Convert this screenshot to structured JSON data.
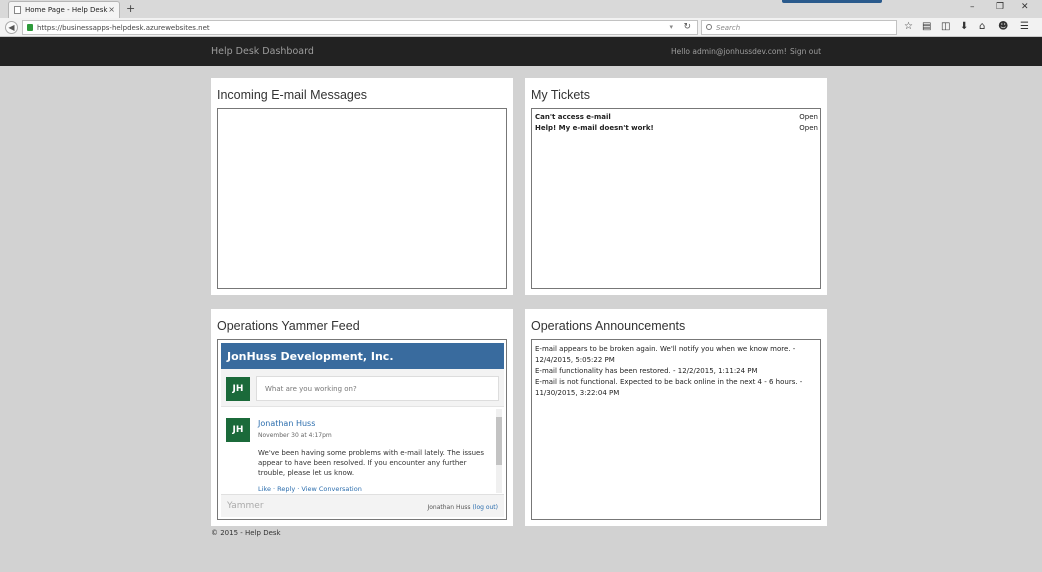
{
  "browser": {
    "tab_title": "Home Page - Help Desk",
    "tab_close": "×",
    "new_tab": "+",
    "url": "https://businessapps-helpdesk.azurewebsites.net",
    "search_placeholder": "Search",
    "window_controls": [
      "–",
      "❐",
      "✕"
    ],
    "toolbar_icons": [
      "star-icon",
      "clipboard-icon",
      "pocket-icon",
      "download-icon",
      "home-icon",
      "chat-icon",
      "menu-icon"
    ]
  },
  "nav": {
    "brand": "Help Desk Dashboard",
    "greeting": "Hello admin@jonhussdev.com!",
    "signout": "Sign out"
  },
  "panels": {
    "email": {
      "title": "Incoming E-mail Messages"
    },
    "tickets": {
      "title": "My Tickets",
      "items": [
        {
          "title": "Can't access e-mail",
          "status": "Open"
        },
        {
          "title": "Help! My e-mail doesn't work!",
          "status": "Open"
        }
      ]
    },
    "yammer": {
      "title": "Operations Yammer Feed",
      "network": "JonHuss Development, Inc.",
      "avatar_initials": "JH",
      "placeholder": "What are you working on?",
      "post": {
        "author": "Jonathan Huss",
        "date": "November 30 at 4:17pm",
        "body": "We've been having some problems with e-mail lately. The issues appear to have been resolved. If you encounter any further trouble, please let us know.",
        "actions": "Like · Reply · View Conversation"
      },
      "logo": "Yammer",
      "user": "Jonathan Huss",
      "logout": "(log out)"
    },
    "announcements": {
      "title": "Operations Announcements",
      "items": [
        "E-mail appears to be broken again. We'll notify you when we know more. - 12/4/2015, 5:05:22 PM",
        "E-mail functionality has been restored. - 12/2/2015, 1:11:24 PM",
        "E-mail is not functional. Expected to be back online in the next 4 - 6 hours. - 11/30/2015, 3:22:04 PM"
      ]
    }
  },
  "footer": "© 2015 - Help Desk"
}
